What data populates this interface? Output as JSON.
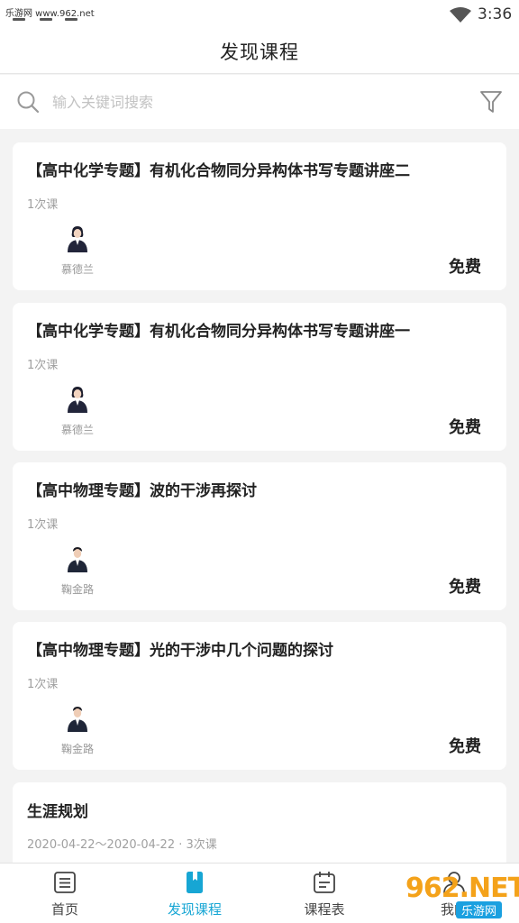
{
  "status": {
    "watermark": "乐游网 www.962.net",
    "time": "3:36"
  },
  "header": {
    "title": "发现课程"
  },
  "search": {
    "placeholder": "输入关键词搜索"
  },
  "courses": [
    {
      "title": "【高中化学专题】有机化合物同分异构体书写专题讲座二",
      "lessons": "1次课",
      "teacher": "慕德兰",
      "price": "免费"
    },
    {
      "title": "【高中化学专题】有机化合物同分异构体书写专题讲座一",
      "lessons": "1次课",
      "teacher": "慕德兰",
      "price": "免费"
    },
    {
      "title": "【高中物理专题】波的干涉再探讨",
      "lessons": "1次课",
      "teacher": "鞠金路",
      "price": "免费"
    },
    {
      "title": "【高中物理专题】光的干涉中几个问题的探讨",
      "lessons": "1次课",
      "teacher": "鞠金路",
      "price": "免费"
    },
    {
      "title": "生涯规划",
      "date_range": "2020-04-22～2020-04-22 · 3次课"
    }
  ],
  "tabs": [
    {
      "label": "首页",
      "icon": "home-list-icon"
    },
    {
      "label": "发现课程",
      "icon": "book-icon"
    },
    {
      "label": "课程表",
      "icon": "calendar-icon"
    },
    {
      "label": "我的",
      "icon": "user-icon"
    }
  ],
  "colors": {
    "accent": "#17a6d4",
    "background": "#f3f3f3"
  },
  "overlay_watermark": {
    "big": "962.NET",
    "small": "乐游网"
  }
}
